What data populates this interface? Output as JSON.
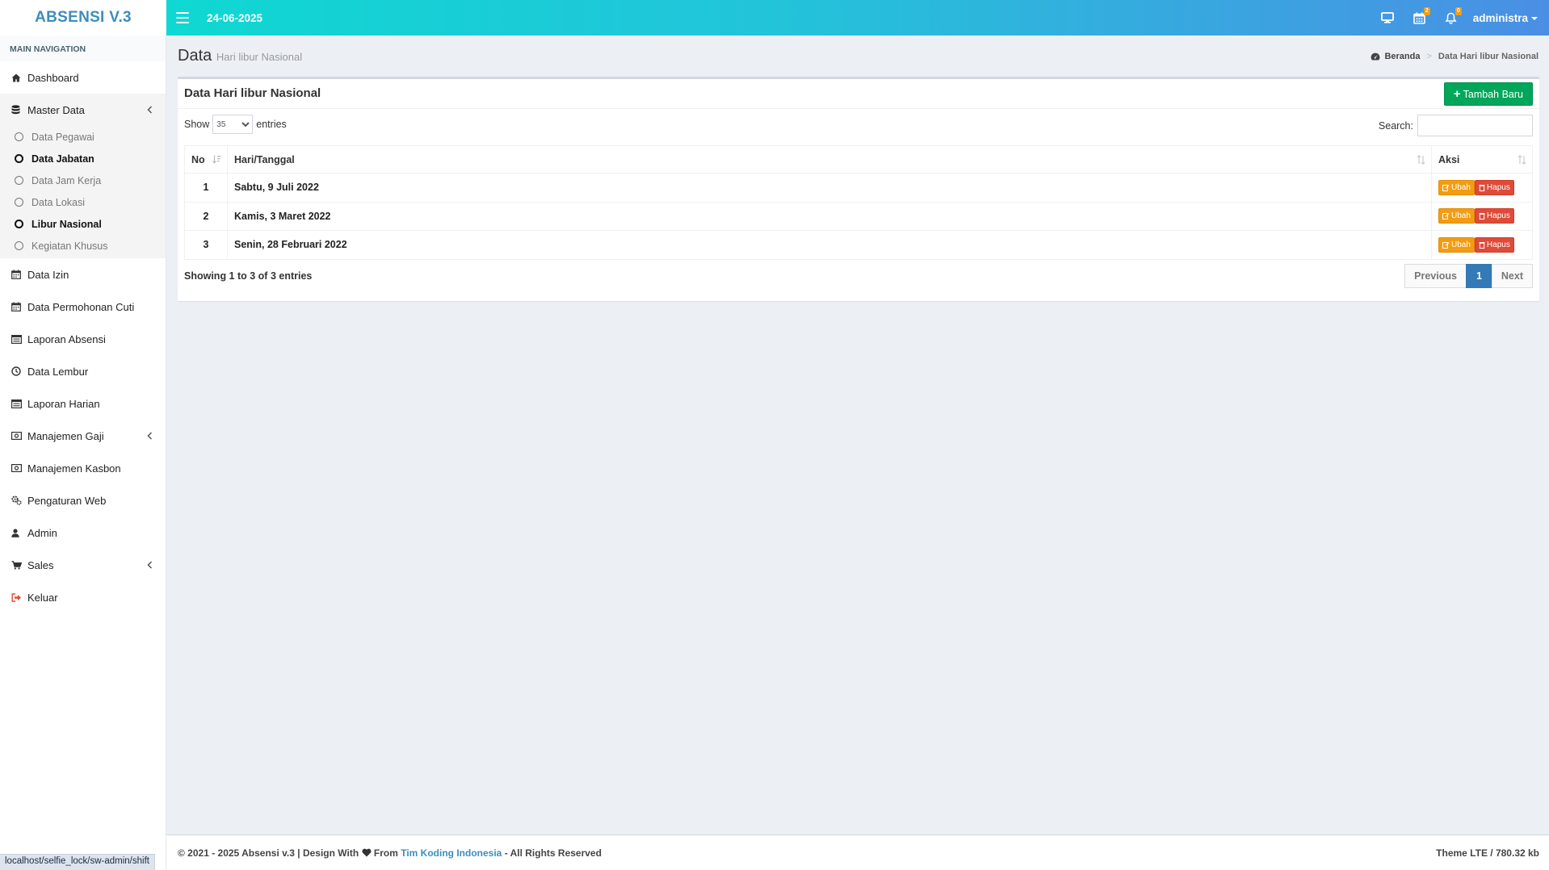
{
  "app": {
    "logo": "ABSENSI V.3"
  },
  "topbar": {
    "date": "24-06-2025",
    "calendar_badge": "2",
    "bell_badge": "0",
    "user": "administra"
  },
  "sidebar": {
    "header": "MAIN NAVIGATION",
    "dashboard": "Dashboard",
    "master_data": "Master Data",
    "master_sub": [
      "Data Pegawai",
      "Data Jabatan",
      "Data Jam Kerja",
      "Data Lokasi",
      "Libur Nasional",
      "Kegiatan Khusus"
    ],
    "data_izin": "Data Izin",
    "data_cuti": "Data Permohonan Cuti",
    "laporan_absensi": "Laporan Absensi",
    "data_lembur": "Data Lembur",
    "laporan_harian": "Laporan Harian",
    "manajemen_gaji": "Manajemen Gaji",
    "manajemen_kasbon": "Manajemen Kasbon",
    "pengaturan_web": "Pengaturan Web",
    "admin": "Admin",
    "sales": "Sales",
    "keluar": "Keluar"
  },
  "header": {
    "title": "Data",
    "subtitle": "Hari libur Nasional"
  },
  "breadcrumb": {
    "home": "Beranda",
    "current": "Data Hari libur Nasional"
  },
  "box": {
    "title": "Data Hari libur Nasional",
    "add_button": "Tambah Baru",
    "show_label": "Show",
    "entries_label": "entries",
    "length_value": "35",
    "search_label": "Search:",
    "columns": [
      "No",
      "Hari/Tanggal",
      "Aksi"
    ],
    "rows": [
      {
        "no": "1",
        "date": "Sabtu, 9 Juli 2022"
      },
      {
        "no": "2",
        "date": "Kamis, 3 Maret 2022"
      },
      {
        "no": "3",
        "date": "Senin, 28 Februari 2022"
      }
    ],
    "edit_label": "Ubah",
    "delete_label": "Hapus",
    "info": "Showing 1 to 3 of 3 entries",
    "pager": {
      "prev": "Previous",
      "page": "1",
      "next": "Next"
    }
  },
  "footer": {
    "prefix": "© 2021 - 2025 Absensi v.3 | Design With",
    "from": "From",
    "link": "Tim Koding Indonesia",
    "suffix": "- All Rights Reserved",
    "right": "Theme LTE / 780.32 kb"
  },
  "status_url": "localhost/selfie_lock/sw-admin/shift",
  "colors": {
    "accent": "#3c8dbc",
    "success": "#00a65a",
    "warning": "#f39c12",
    "danger": "#dd4b39"
  }
}
